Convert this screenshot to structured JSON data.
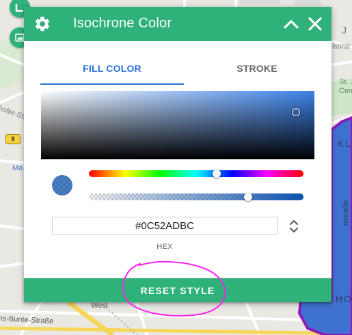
{
  "map": {
    "labels": {
      "top_right_j": "J",
      "strasse_right": "issrat",
      "st_j_line1": "St. J",
      "st_j_line2": "Cem",
      "kl": "KL",
      "strasse_left": "nhofer-Str.",
      "road_number": "8",
      "ma": "Ma",
      "vertical_street": "nstraße",
      "ho": "HO",
      "west": "West",
      "bottom_street": "ns-Bunte-Straße"
    },
    "colors": {
      "isochrone_fill": "#3f72d0",
      "isochrone_stroke": "#8c1ab8",
      "green_area": "#cde6c8"
    }
  },
  "panel": {
    "title": "Isochrone Color",
    "icons": {
      "settings": "gear-icon",
      "collapse": "chevron-up-icon",
      "close": "close-icon"
    },
    "tabs": {
      "fill": "FILL COLOR",
      "stroke": "STROKE"
    },
    "active_tab": "fill",
    "picker": {
      "hex_value": "#0C52ADBC",
      "hex_label": "HEX",
      "hue_position_percent": 60,
      "alpha_position_percent": 74,
      "saturation_percent": 93,
      "brightness_percent": 68
    },
    "reset_label": "RESET STYLE",
    "colors": {
      "header": "#2fb17a",
      "active_tab": "#2a6fd6",
      "selected_color": "#0C52AD"
    }
  },
  "annotation": {
    "color": "#ff22ee"
  }
}
